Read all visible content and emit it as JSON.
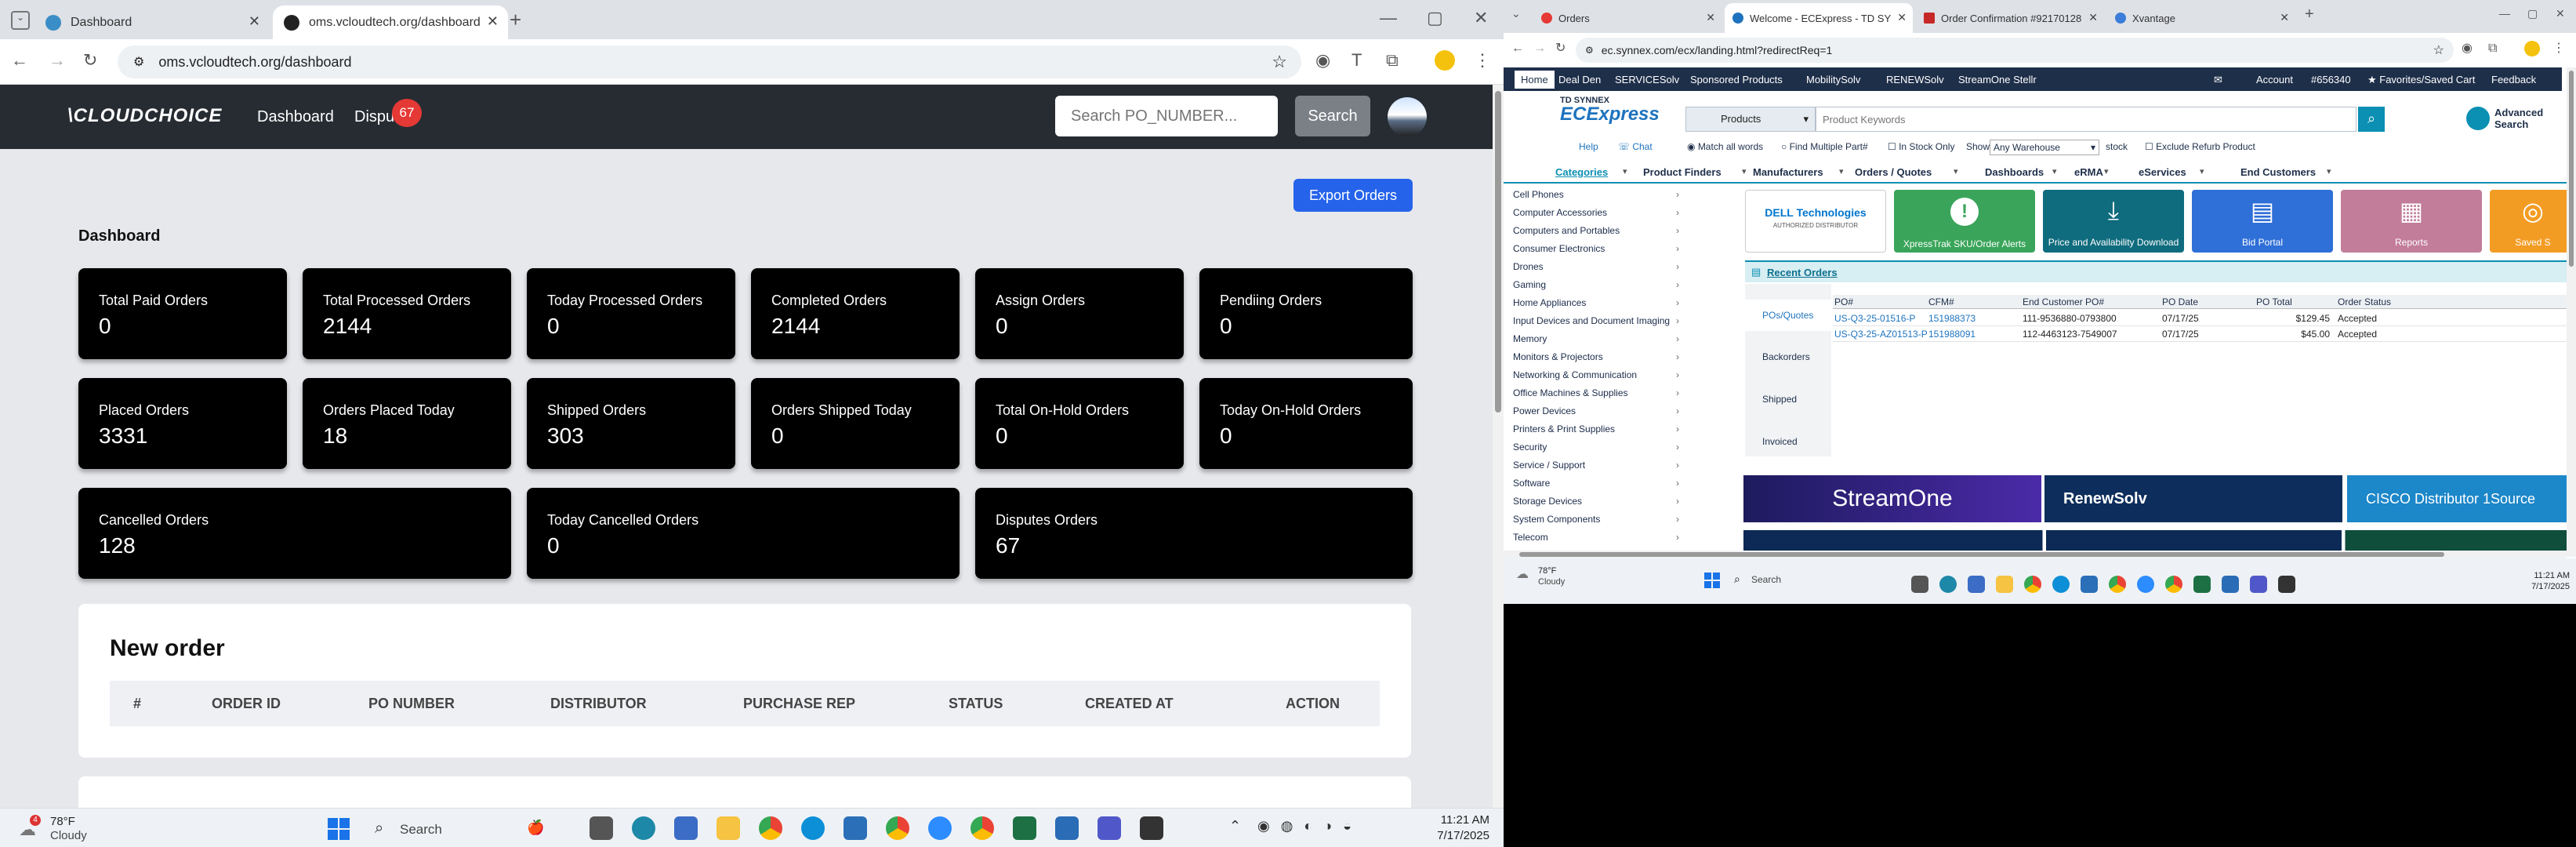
{
  "left_browser": {
    "tabs": [
      {
        "label": "Dashboard",
        "active": false
      },
      {
        "label": "oms.vcloudtech.org/dashboard",
        "active": true
      }
    ],
    "url": "oms.vcloudtech.org/dashboard",
    "window_controls": {
      "min": "—",
      "max": "▢",
      "close": "✕"
    }
  },
  "app": {
    "logo": "CLOUDCHOICE",
    "nav_dashboard": "Dashboard",
    "nav_disputes": "Dispu",
    "disputes_badge": "67",
    "search_placeholder": "Search PO_NUMBER...",
    "search_button": "Search",
    "export_button": "Export Orders",
    "page_title": "Dashboard",
    "cards": [
      {
        "title": "Total Paid Orders",
        "value": "0"
      },
      {
        "title": "Total Processed Orders",
        "value": "2144"
      },
      {
        "title": "Today Processed Orders",
        "value": "0"
      },
      {
        "title": "Completed Orders",
        "value": "2144"
      },
      {
        "title": "Assign Orders",
        "value": "0"
      },
      {
        "title": "Pendiing Orders",
        "value": "0"
      },
      {
        "title": "Placed Orders",
        "value": "3331"
      },
      {
        "title": "Orders Placed Today",
        "value": "18"
      },
      {
        "title": "Shipped Orders",
        "value": "303"
      },
      {
        "title": "Orders Shipped Today",
        "value": "0"
      },
      {
        "title": "Total On-Hold Orders",
        "value": "0"
      },
      {
        "title": "Today On-Hold Orders",
        "value": "0"
      },
      {
        "title": "Cancelled Orders",
        "value": "128"
      },
      {
        "title": "Today Cancelled Orders",
        "value": "0"
      },
      {
        "title": "Disputes Orders",
        "value": "67"
      }
    ],
    "new_order_title": "New order",
    "table_headers": [
      "#",
      "ORDER ID",
      "PO NUMBER",
      "DISTRIBUTOR",
      "PURCHASE REP",
      "STATUS",
      "CREATED AT",
      "ACTION"
    ]
  },
  "left_taskbar": {
    "weather_temp": "78°F",
    "weather_desc": "Cloudy",
    "weather_badge": "4",
    "search": "Search",
    "time": "11:21 AM",
    "date": "7/17/2025"
  },
  "right_browser": {
    "tabs": [
      {
        "label": "Orders"
      },
      {
        "label": "Welcome - ECExpress - TD SYNNEX"
      },
      {
        "label": "Order Confirmation #92170128"
      },
      {
        "label": "Xvantage"
      }
    ],
    "url": "ec.synnex.com/ecx/landing.html?redirectReq=1"
  },
  "synnex": {
    "topnav": [
      "Home",
      "Deal Den",
      "SERVICESolv",
      "Sponsored Products",
      "MobilitySolv",
      "RENEWSolv",
      "StreamOne Stellr"
    ],
    "account": "Account",
    "account_num": "#656340",
    "favorites": "★ Favorites/Saved Cart",
    "feedback": "Feedback",
    "brand_small": "TD SYNNEX",
    "brand_big": "ECExpress",
    "products_select": "Products",
    "keyword_placeholder": "Product Keywords",
    "advanced_search": "Advanced Search",
    "help": "Help",
    "chat": "Chat",
    "match_all": "Match all words",
    "find_multiple": "Find Multiple Part#",
    "in_stock": "In Stock Only",
    "show": "Show",
    "warehouse": "Any Warehouse",
    "stock": "stock",
    "exclude": "Exclude Refurb Product",
    "menu": [
      "Categories",
      "Product Finders",
      "Manufacturers",
      "Orders / Quotes",
      "Dashboards",
      "eRMA",
      "eServices",
      "End Customers"
    ],
    "categories": [
      "Cell Phones",
      "Computer Accessories",
      "Computers and Portables",
      "Consumer Electronics",
      "Drones",
      "Gaming",
      "Home Appliances",
      "Input Devices and Document Imaging",
      "Memory",
      "Monitors & Projectors",
      "Networking & Communication",
      "Office Machines & Supplies",
      "Power Devices",
      "Printers & Print Supplies",
      "Security",
      "Service / Support",
      "Software",
      "Storage Devices",
      "System Components",
      "Telecom"
    ],
    "dell_tile": "DELL Technologies",
    "dell_sub": "AUTHORIZED DISTRIBUTOR",
    "tiles": [
      "XpressTrak SKU/Order Alerts",
      "Price and Availability Download",
      "Bid Portal",
      "Reports",
      "Saved S"
    ],
    "recent_orders": "Recent Orders",
    "side_tabs": [
      "POs/Quotes",
      "Backorders",
      "Shipped",
      "Invoiced"
    ],
    "order_headers": [
      "PO#",
      "CFM#",
      "End Customer PO#",
      "PO Date",
      "PO Total",
      "Order Status"
    ],
    "orders": [
      [
        "US-Q3-25-01516-P",
        "151988373",
        "111-9536880-0793800",
        "07/17/25",
        "$129.45",
        "Accepted"
      ],
      [
        "US-Q3-25-AZ01513-P",
        "151988091",
        "112-4463123-7549007",
        "07/17/25",
        "$45.00",
        "Accepted"
      ]
    ],
    "banners": [
      "StreamOne",
      "RenewSolv",
      "CISCO Distributor 1Source"
    ]
  },
  "right_taskbar": {
    "weather_temp": "78°F",
    "weather_desc": "Cloudy",
    "search": "Search",
    "time": "11:21 AM",
    "date": "7/17/2025"
  }
}
